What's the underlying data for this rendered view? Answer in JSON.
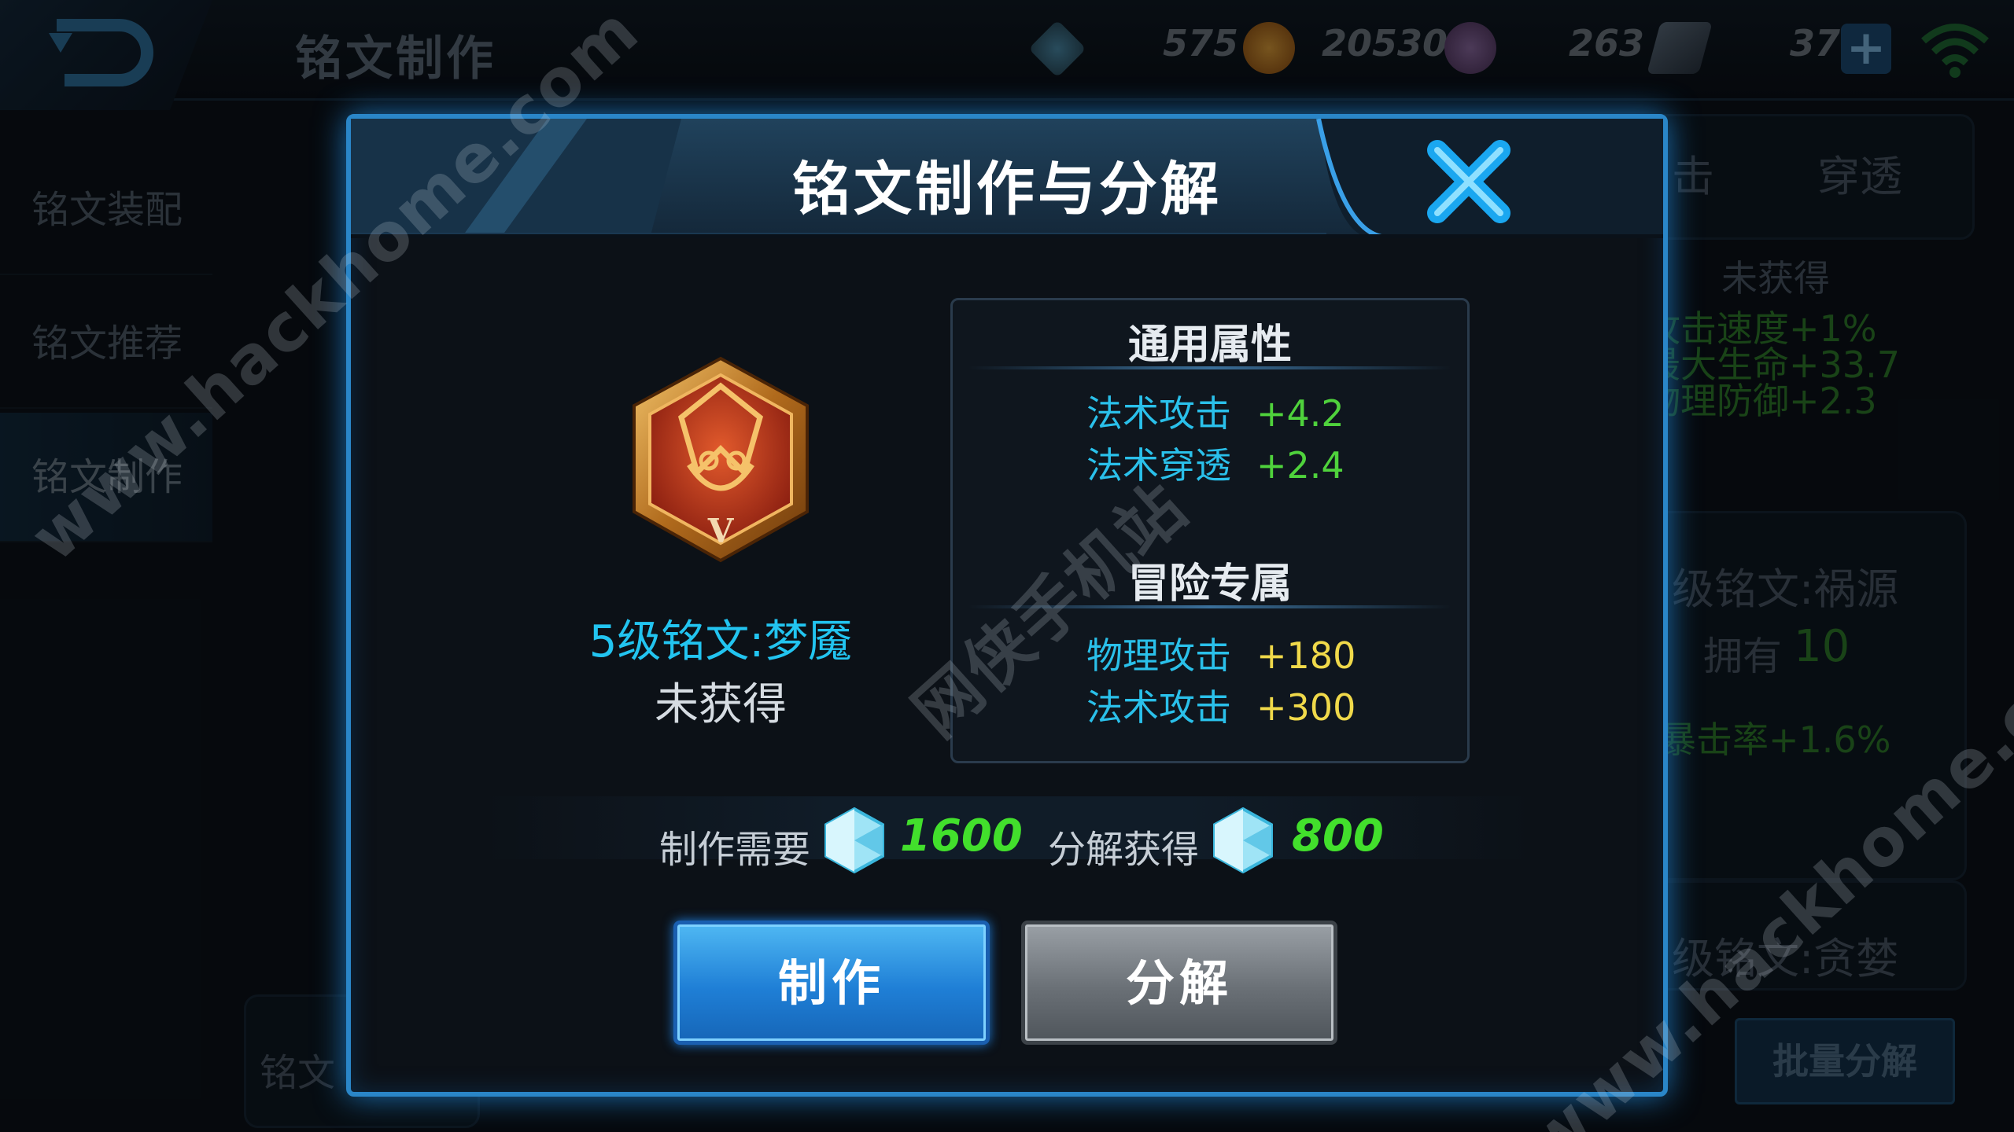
{
  "topbar": {
    "title": "铭文制作",
    "resources": [
      {
        "icon": "crystal-icon",
        "value": "575"
      },
      {
        "icon": "gold-coin-icon",
        "value": "20530"
      },
      {
        "icon": "diamond-icon",
        "value": "263"
      },
      {
        "icon": "voucher-icon",
        "value": "37"
      }
    ],
    "add_icon": "plus-icon"
  },
  "sidebar": {
    "items": [
      {
        "label": "铭文装配"
      },
      {
        "label": "铭文推荐"
      },
      {
        "label": "铭文制作"
      }
    ]
  },
  "background": {
    "tab_1": "击",
    "tab_2": "穿透",
    "status_top": "未获得",
    "stats_top": [
      "攻击速度+1%",
      "最大生命+33.7",
      "物理防御+2.3"
    ],
    "rune_2_name": "级铭文:祸源",
    "own_label": "拥有",
    "own_count": "10",
    "crit_line": "暴击率+1.6%",
    "rune_3_name": "级铭文:贪婪",
    "left_partial": "铭文",
    "batch_decompose": "批量分解"
  },
  "watermark": {
    "site_1": "www.hackhome.com",
    "site_2": "www.hackhome.com",
    "site_cn": "网侠手机站"
  },
  "dialog": {
    "title": "铭文制作与分解",
    "rune": {
      "level_badge": "V",
      "name": "5级铭文:梦魇",
      "status": "未获得"
    },
    "general_section": {
      "title": "通用属性",
      "stats": [
        {
          "name": "法术攻击",
          "value": "+4.2"
        },
        {
          "name": "法术穿透",
          "value": "+2.4"
        }
      ]
    },
    "adventure_section": {
      "title": "冒险专属",
      "stats": [
        {
          "name": "物理攻击",
          "value": "+180"
        },
        {
          "name": "法术攻击",
          "value": "+300"
        }
      ]
    },
    "cost": {
      "craft_label": "制作需要",
      "craft_value": "1600",
      "decompose_label": "分解获得",
      "decompose_value": "800"
    },
    "buttons": {
      "craft": "制作",
      "decompose": "分解"
    }
  },
  "colors": {
    "accent_blue": "#2a86c8",
    "stat_name_cyan": "#2ac0ea",
    "stat_value_green": "#4fd23c",
    "stat_value_gold": "#f0d94a",
    "cost_green": "#42df2c"
  }
}
